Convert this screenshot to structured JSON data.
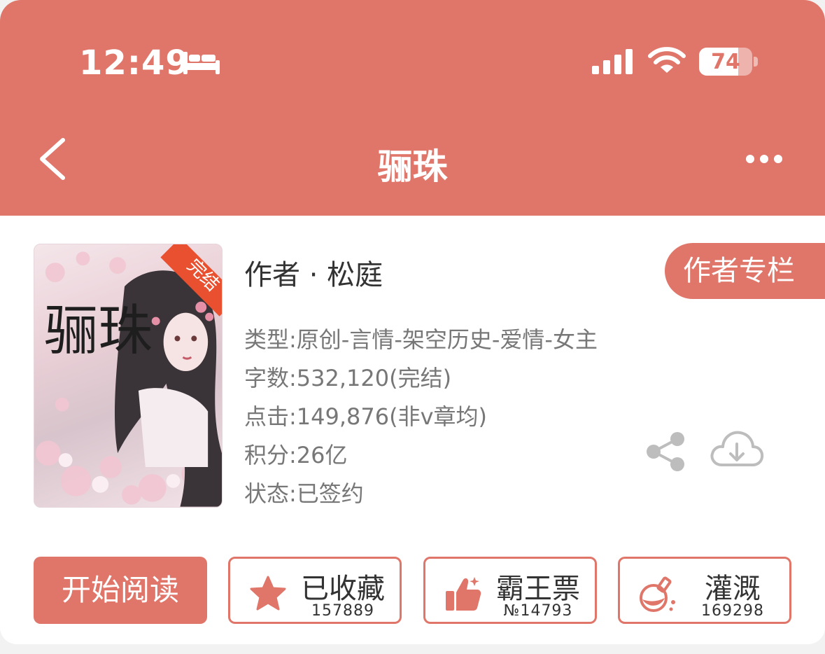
{
  "status_bar": {
    "time": "12:49",
    "battery": "74",
    "battery_level": 0.74
  },
  "nav": {
    "title": "骊珠"
  },
  "book": {
    "cover_badge": "完结",
    "cover_title": "骊珠",
    "author_label": "作者 · 松庭",
    "author_column_button": "作者专栏",
    "genre": "类型:原创-言情-架空历史-爱情-女主",
    "word_count": "字数:532,120(完结)",
    "clicks": "点击:149,876(非v章均)",
    "points": "积分:26亿",
    "status": "状态:已签约"
  },
  "actions": {
    "start_reading": "开始阅读",
    "collected_label": "已收藏",
    "collected_count": "157889",
    "vote_label": "霸王票",
    "vote_count": "№14793",
    "nourish_label": "灌溉",
    "nourish_count": "169298"
  },
  "colors": {
    "accent": "#e0766a",
    "text_dark": "#333333",
    "text_muted": "#777777",
    "icon_gray": "#bdbdbd"
  }
}
